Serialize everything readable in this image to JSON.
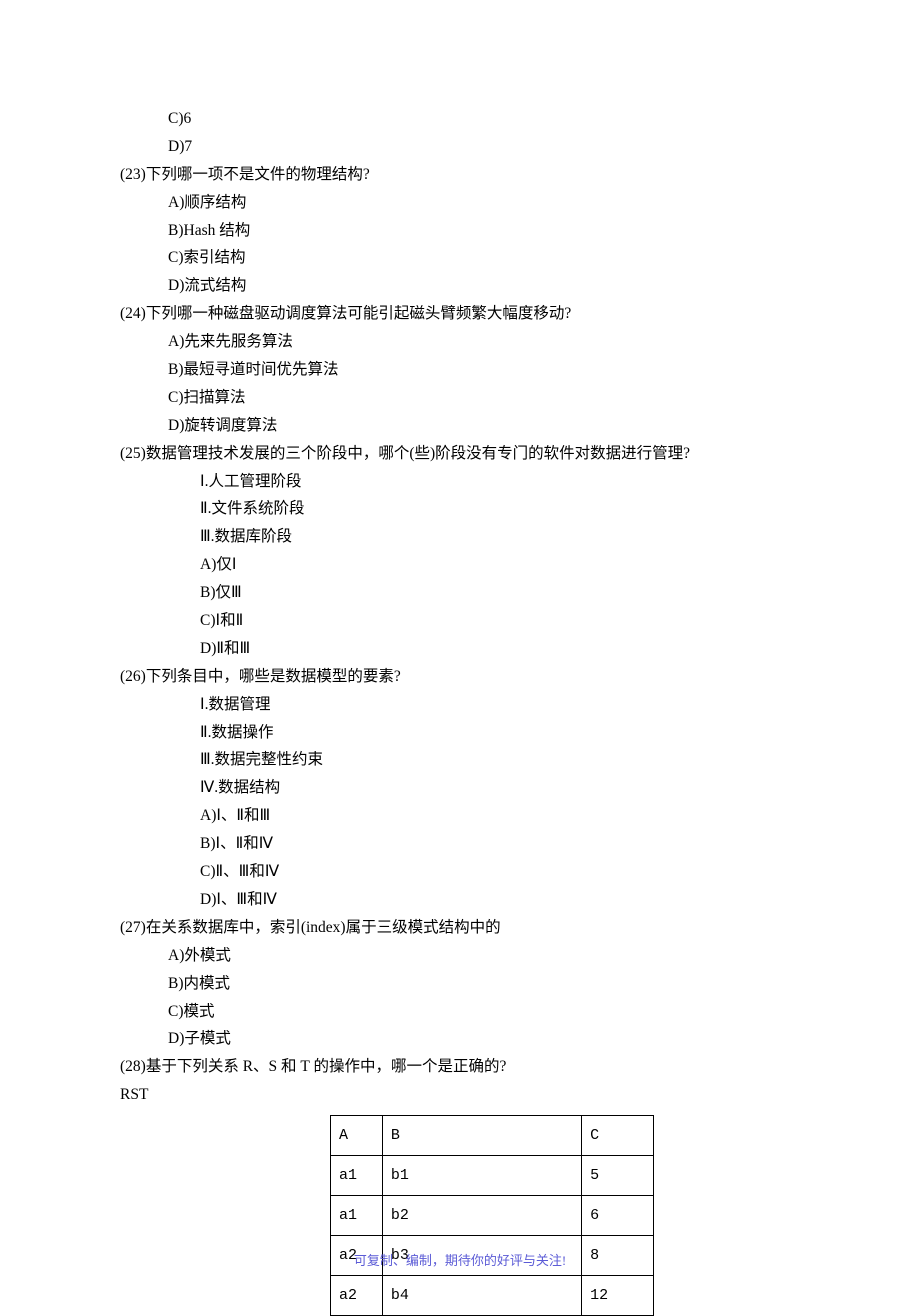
{
  "pre_options": [
    "C)6",
    "D)7"
  ],
  "questions": [
    {
      "stem": "(23)下列哪一项不是文件的物理结构?",
      "options": [
        "A)顺序结构",
        "B)Hash 结构",
        "C)索引结构",
        "D)流式结构"
      ]
    },
    {
      "stem": "(24)下列哪一种磁盘驱动调度算法可能引起磁头臂频繁大幅度移动?",
      "options": [
        "A)先来先服务算法",
        "B)最短寻道时间优先算法",
        "C)扫描算法",
        "D)旋转调度算法"
      ]
    },
    {
      "stem": "(25)数据管理技术发展的三个阶段中，哪个(些)阶段没有专门的软件对数据进行管理?",
      "roman": [
        "Ⅰ.人工管理阶段",
        "Ⅱ.文件系统阶段",
        "Ⅲ.数据库阶段"
      ],
      "options": [
        "A)仅Ⅰ",
        "B)仅Ⅲ",
        "C)Ⅰ和Ⅱ",
        "D)Ⅱ和Ⅲ"
      ]
    },
    {
      "stem": "(26)下列条目中，哪些是数据模型的要素?",
      "roman": [
        "Ⅰ.数据管理",
        "Ⅱ.数据操作",
        "Ⅲ.数据完整性约束",
        "Ⅳ.数据结构"
      ],
      "options": [
        "A)Ⅰ、Ⅱ和Ⅲ",
        "B)Ⅰ、Ⅱ和Ⅳ",
        "C)Ⅱ、Ⅲ和Ⅳ",
        "D)Ⅰ、Ⅲ和Ⅳ"
      ]
    },
    {
      "stem": "(27)在关系数据库中，索引(index)属于三级模式结构中的",
      "options": [
        "A)外模式",
        "B)内模式",
        "C)模式",
        "D)子模式"
      ]
    }
  ],
  "q28_stem": "(28)基于下列关系 R、S 和 T 的操作中，哪一个是正确的?",
  "q28_label": "RST",
  "table": {
    "rows": [
      [
        "A",
        "B",
        "C"
      ],
      [
        "a1",
        "b1",
        "5"
      ],
      [
        "a1",
        "b2",
        "6"
      ],
      [
        "a2",
        "b3",
        "8"
      ],
      [
        "a2",
        "b4",
        "12"
      ]
    ]
  },
  "footer": "可复制、编制，期待你的好评与关注!"
}
